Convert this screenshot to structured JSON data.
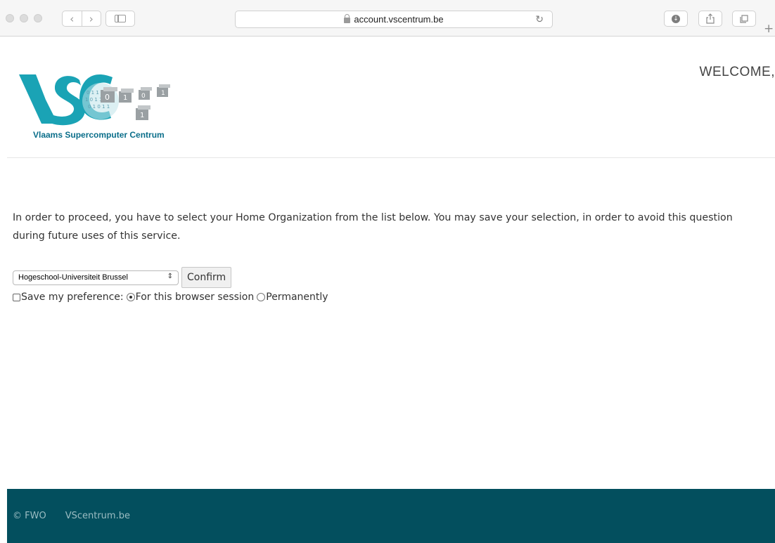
{
  "browser": {
    "url": "account.vscentrum.be",
    "back_icon": "chevron-left-icon",
    "forward_icon": "chevron-right-icon",
    "reload_icon": "reload-icon",
    "plus_label": "+"
  },
  "header": {
    "logo_text": "Vlaams Supercomputer Centrum",
    "welcome": "WELCOME,"
  },
  "main": {
    "intro": "In order to proceed, you have to select your Home Organization from the list below. You may save your selection, in order to avoid this question during future uses of this service.",
    "organization_select": {
      "selected": "Hogeschool-Universiteit Brussel"
    },
    "confirm_label": "Confirm",
    "save_label": "Save my preference:",
    "session_option": "For this browser session",
    "permanent_option": "Permanently",
    "save_checked": false,
    "selected_option": "session"
  },
  "footer": {
    "copyright": "© FWO",
    "link": "VScentrum.be"
  },
  "colors": {
    "brand_teal": "#1aa3b5",
    "footer_bg": "#034f5e",
    "logo_text": "#0a6e8a"
  }
}
